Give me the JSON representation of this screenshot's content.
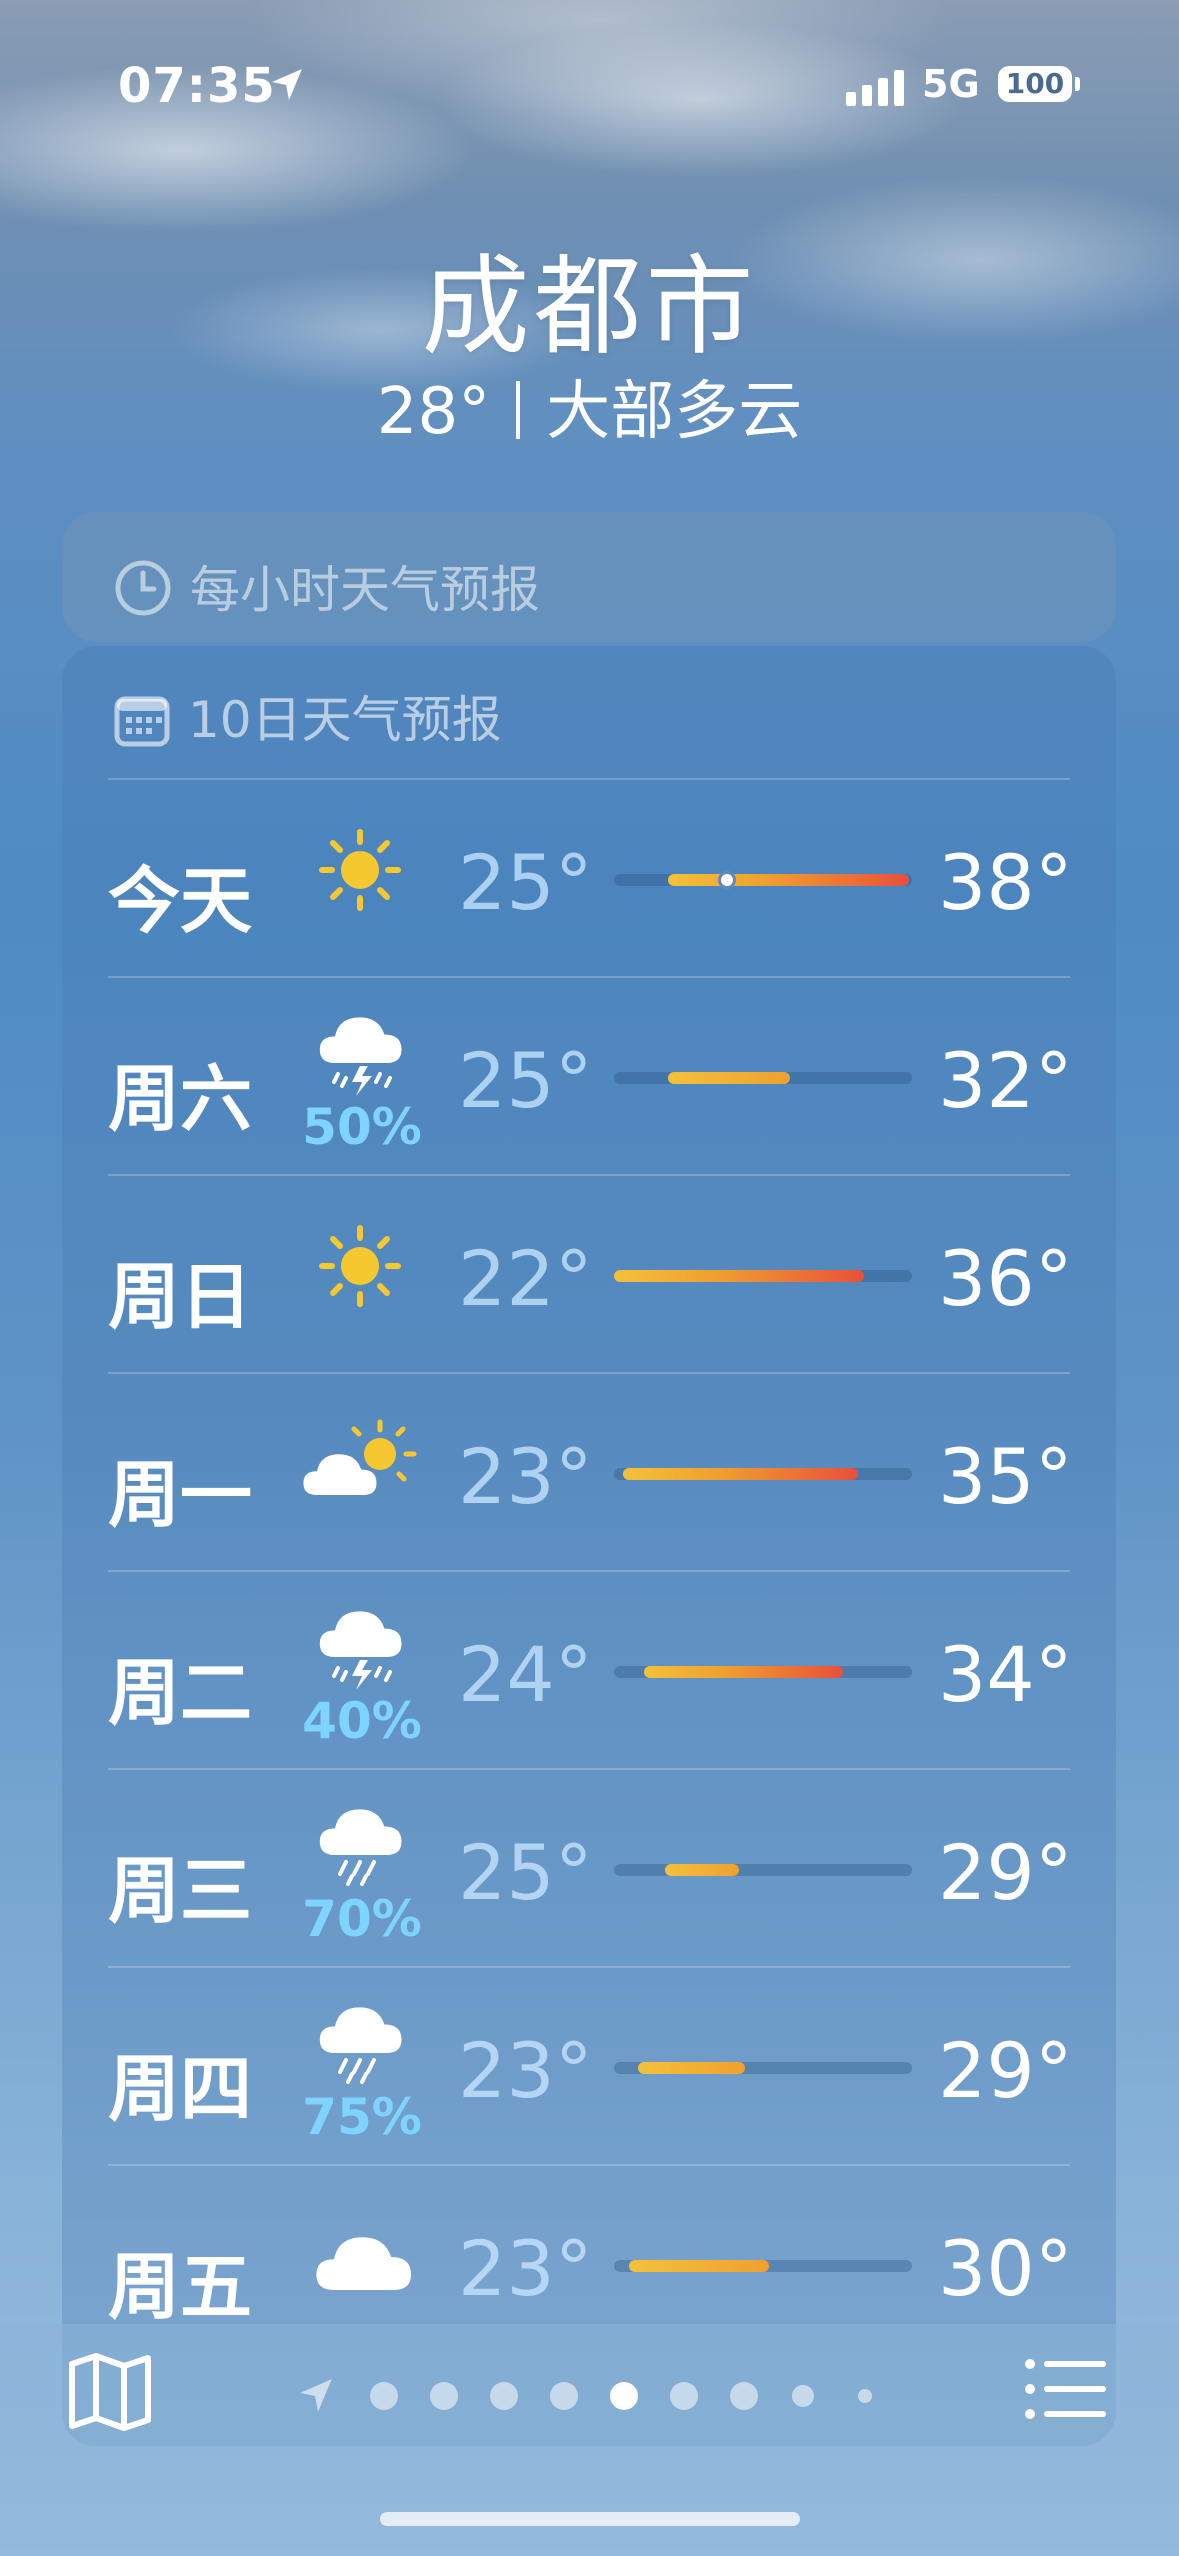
{
  "status": {
    "time": "07:35",
    "network": "5G",
    "battery": "100"
  },
  "header": {
    "city": "成都市",
    "temperature": "28°",
    "condition": "大部多云"
  },
  "hourly_card": {
    "title": "每小时天气预报",
    "icon": "clock-icon"
  },
  "daily_card": {
    "title": "10日天气预报",
    "icon": "calendar-icon",
    "days": [
      {
        "label": "今天",
        "icon": "sun-icon",
        "precip": "",
        "low": "25°",
        "high": "38°",
        "bar_start": 0.18,
        "bar_end": 0.99,
        "current_marker": 0.38
      },
      {
        "label": "周六",
        "icon": "thunderstorm-icon",
        "precip": "50%",
        "low": "25°",
        "high": "32°",
        "bar_start": 0.18,
        "bar_end": 0.59
      },
      {
        "label": "周日",
        "icon": "sun-icon",
        "precip": "",
        "low": "22°",
        "high": "36°",
        "bar_start": 0.0,
        "bar_end": 0.84
      },
      {
        "label": "周一",
        "icon": "partly-sunny-icon",
        "precip": "",
        "low": "23°",
        "high": "35°",
        "bar_start": 0.03,
        "bar_end": 0.82
      },
      {
        "label": "周二",
        "icon": "thunderstorm-icon",
        "precip": "40%",
        "low": "24°",
        "high": "34°",
        "bar_start": 0.1,
        "bar_end": 0.77
      },
      {
        "label": "周三",
        "icon": "rain-icon",
        "precip": "70%",
        "low": "25°",
        "high": "29°",
        "bar_start": 0.17,
        "bar_end": 0.42
      },
      {
        "label": "周四",
        "icon": "rain-icon",
        "precip": "75%",
        "low": "23°",
        "high": "29°",
        "bar_start": 0.08,
        "bar_end": 0.44
      },
      {
        "label": "周五",
        "icon": "cloud-icon",
        "precip": "",
        "low": "23°",
        "high": "30°",
        "bar_start": 0.05,
        "bar_end": 0.52
      }
    ]
  },
  "toolbar": {
    "map_icon": "map-icon",
    "list_icon": "list-icon",
    "pages": 9,
    "active_page": 5
  },
  "colors": {
    "precip": "#7fd3ff",
    "bar_orange": "#f0a030",
    "bar_red": "#e8503a",
    "bar_yellow": "#f3c13a"
  }
}
